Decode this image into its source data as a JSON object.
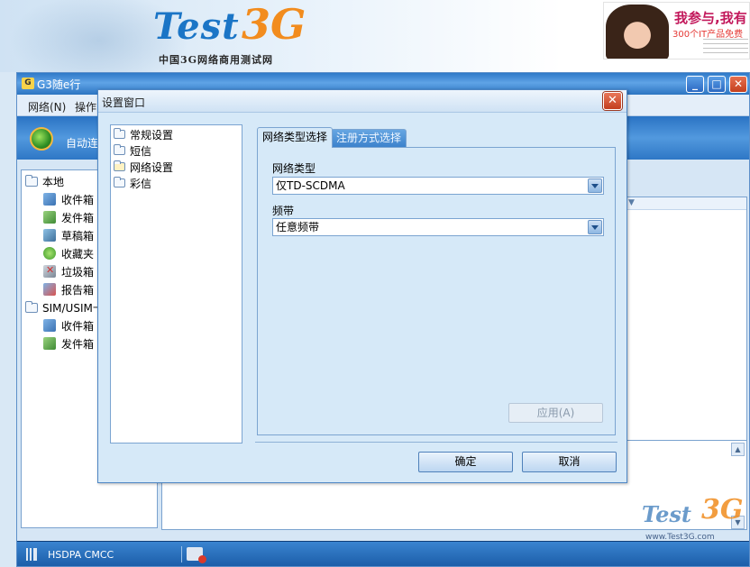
{
  "banner": {
    "logo_text": "Test",
    "logo_3g": "3G",
    "logo_subtitle": "中国3G网络商用测试网",
    "ad_headline": "我参与,我有",
    "ad_sub": "300个IT产品免费"
  },
  "app": {
    "title": "G3随e行",
    "menu": [
      "网络(N)",
      "操作"
    ],
    "toolbar": {
      "auto_connect_label": "自动连"
    },
    "tree": {
      "local_root": "本地",
      "local_items": [
        "收件箱",
        "发件箱",
        "草稿箱",
        "收藏夹",
        "垃圾箱",
        "报告箱"
      ],
      "sim_root": "SIM/USIM卡",
      "sim_items": [
        "收件箱",
        "发件箱"
      ]
    },
    "status": {
      "network": "HSDPA CMCC"
    }
  },
  "watermark": {
    "logo": "Test",
    "mark": "3G",
    "url": "www.Test3G.com"
  },
  "dialog": {
    "title": "设置窗口",
    "nav": [
      "常规设置",
      "短信",
      "网络设置",
      "彩信"
    ],
    "selected_nav": "网络设置",
    "tabs": [
      "网络类型选择",
      "注册方式选择"
    ],
    "active_tab": "网络类型选择",
    "network_type_label": "网络类型",
    "network_type_value": "仅TD-SCDMA",
    "band_label": "频带",
    "band_value": "任意频带",
    "apply_label": "应用(A)",
    "ok_label": "确定",
    "cancel_label": "取消"
  },
  "colors": {
    "titlebar_blue": "#2e79c8",
    "dialog_bg": "#d6e9f8",
    "close_red": "#c33e1f",
    "logo_blue": "#1b75c6",
    "logo_orange": "#f28c1e"
  }
}
